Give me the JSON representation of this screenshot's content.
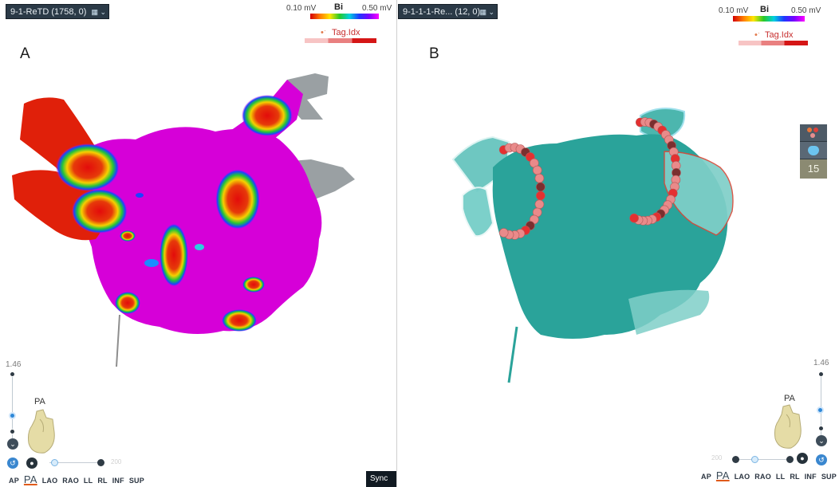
{
  "panel_a": {
    "map_selector": "9-1-ReTD (1758, 0)",
    "map_selector_icon": "map-options-icon",
    "scale": {
      "min": "0.10 mV",
      "name": "Bi",
      "max": "0.50 mV"
    },
    "tag_legend": "Tag.Idx",
    "letter": "A",
    "zoom_value": "1.46",
    "view_label": "PA",
    "view_tabs": [
      "AP",
      "PA",
      "LAO",
      "RAO",
      "LL",
      "RL",
      "INF",
      "SUP"
    ],
    "active_view": "PA",
    "slider_value_label": "200"
  },
  "panel_b": {
    "map_selector": "9-1-1-1-Re... (12, 0)",
    "map_selector_icon": "map-options-icon",
    "scale": {
      "min": "0.10 mV",
      "name": "Bi",
      "max": "0.50 mV"
    },
    "tag_legend": "Tag.Idx",
    "letter": "B",
    "zoom_value": "1.46",
    "view_label": "PA",
    "view_tabs": [
      "AP",
      "PA",
      "LAO",
      "RAO",
      "LL",
      "RL",
      "INF",
      "SUP"
    ],
    "active_view": "PA",
    "slider_value_label": "200",
    "side_toolbar": {
      "tag_count": "15",
      "icons": [
        "tags-icon",
        "transparency-icon"
      ]
    }
  },
  "sync_button": "Sync",
  "colors": {
    "voltage_healthy": "#ff00ff",
    "voltage_scar": "#e81a0a",
    "shell_teal": "#2aa39a",
    "ablation_tag": "#e57d7d",
    "toolbar_dark": "#2b3a47"
  }
}
